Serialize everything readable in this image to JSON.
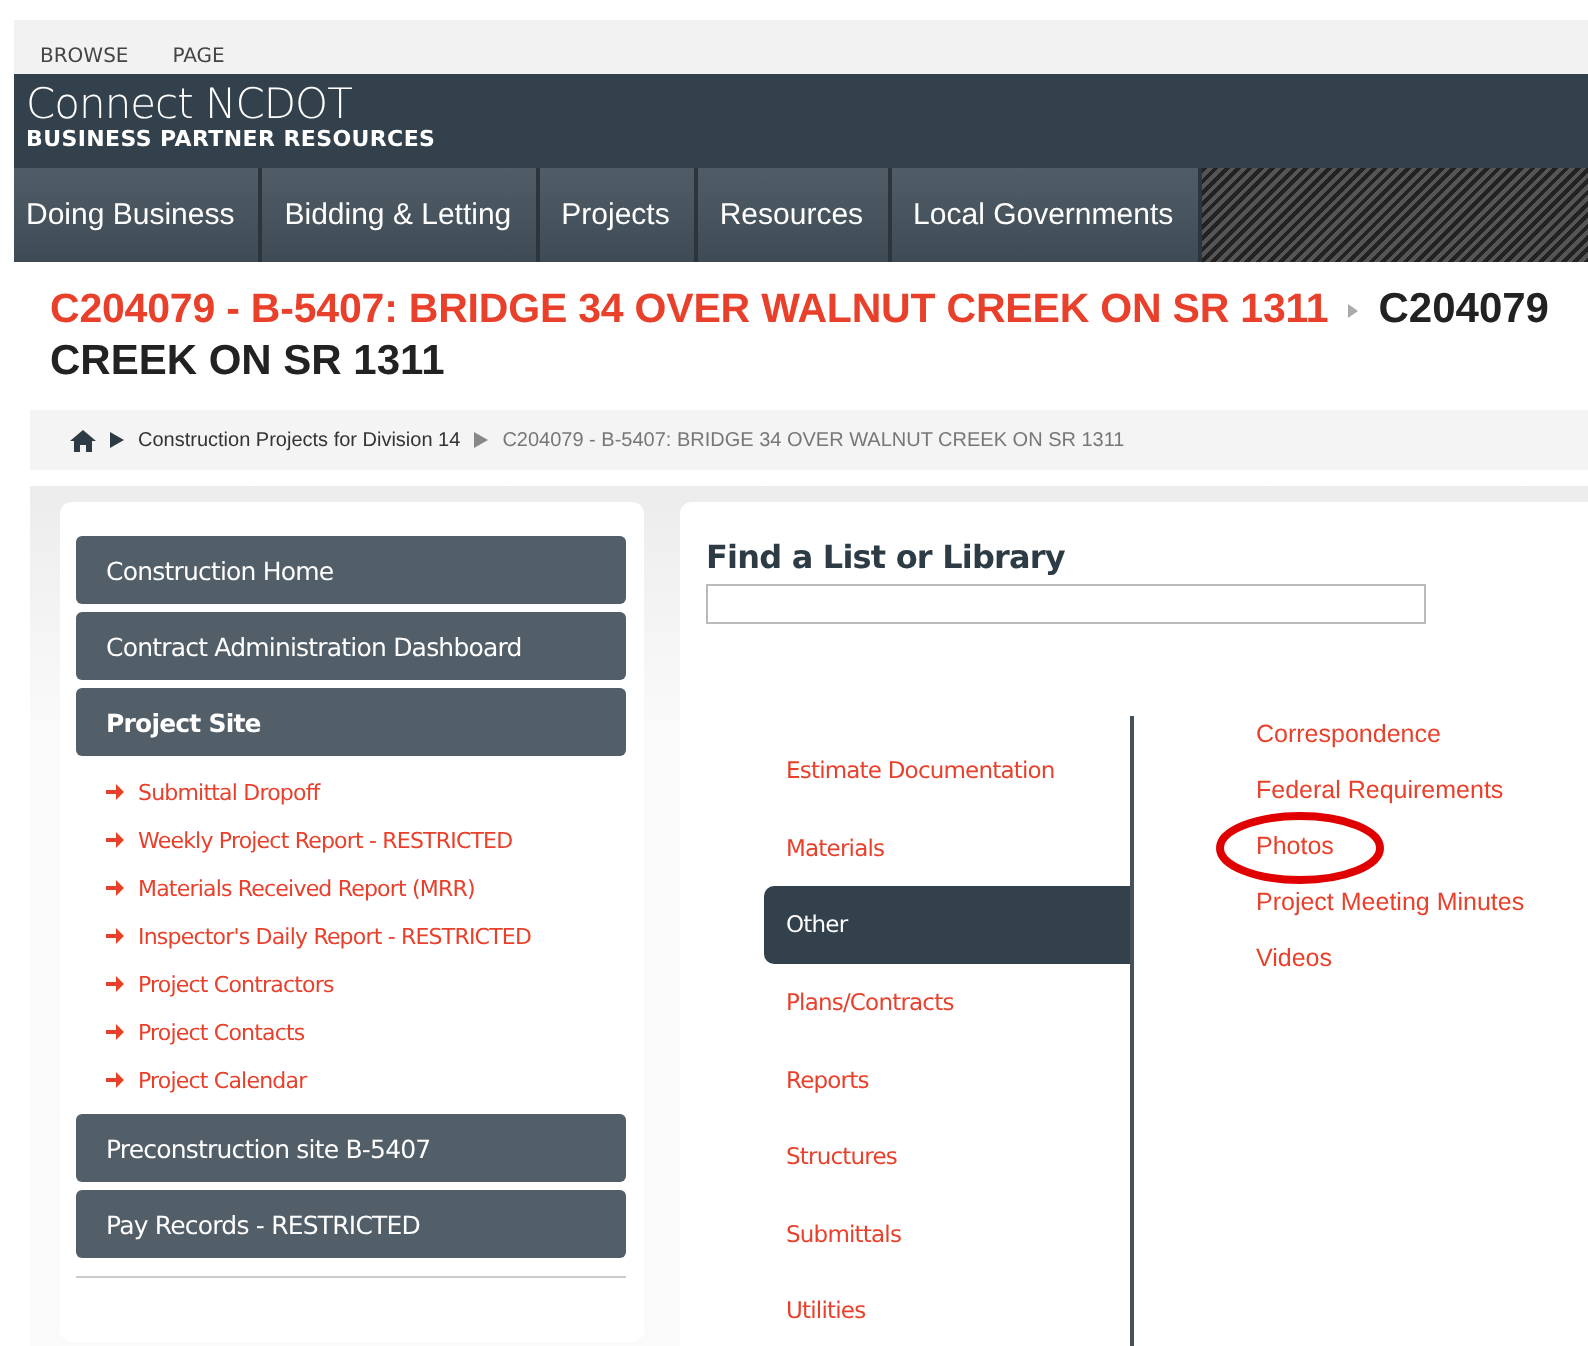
{
  "ribbon": {
    "tabs": [
      {
        "label": "BROWSE",
        "selected": false
      },
      {
        "label": "PAGE",
        "selected": false
      }
    ]
  },
  "header": {
    "site_title": "Connect NCDOT",
    "subtitle": "BUSINESS PARTNER RESOURCES"
  },
  "nav": {
    "items": [
      "Doing Business",
      "Bidding & Letting",
      "Projects",
      "Resources",
      "Local Governments"
    ]
  },
  "page_title": {
    "site_part": "C204079 - B-5407: BRIDGE 34 OVER WALNUT CREEK ON SR 1311",
    "page_part_start": "C204079",
    "page_part_end": "CREEK ON SR 1311"
  },
  "breadcrumb": {
    "items": [
      "Construction Projects for Division 14",
      "C204079 - B-5407: BRIDGE 34 OVER WALNUT CREEK ON SR 1311"
    ]
  },
  "sidebar": {
    "items": [
      {
        "label": "Construction Home",
        "selected": false
      },
      {
        "label": "Contract Administration Dashboard",
        "selected": false
      },
      {
        "label": "Project Site",
        "selected": true,
        "children": [
          "Submittal Dropoff",
          "Weekly Project Report - RESTRICTED",
          "Materials Received Report (MRR)",
          "Inspector's Daily Report - RESTRICTED",
          "Project Contractors",
          "Project Contacts",
          "Project Calendar"
        ]
      },
      {
        "label": "Preconstruction site B-5407",
        "selected": false
      },
      {
        "label": "Pay Records - RESTRICTED",
        "selected": false
      }
    ]
  },
  "finder": {
    "heading": "Find a List or Library",
    "categories": [
      {
        "label": "Estimate Documentation",
        "selected": false
      },
      {
        "label": "Materials",
        "selected": false
      },
      {
        "label": "Other",
        "selected": true
      },
      {
        "label": "Plans/Contracts",
        "selected": false
      },
      {
        "label": "Reports",
        "selected": false
      },
      {
        "label": "Structures",
        "selected": false
      },
      {
        "label": "Submittals",
        "selected": false
      },
      {
        "label": "Utilities",
        "selected": false
      }
    ],
    "libraries": [
      {
        "label": "Correspondence",
        "circled": false
      },
      {
        "label": "Federal Requirements",
        "circled": false
      },
      {
        "label": "Photos",
        "circled": true
      },
      {
        "label": "Project Meeting Minutes",
        "circled": false
      },
      {
        "label": "Videos",
        "circled": false
      }
    ]
  }
}
